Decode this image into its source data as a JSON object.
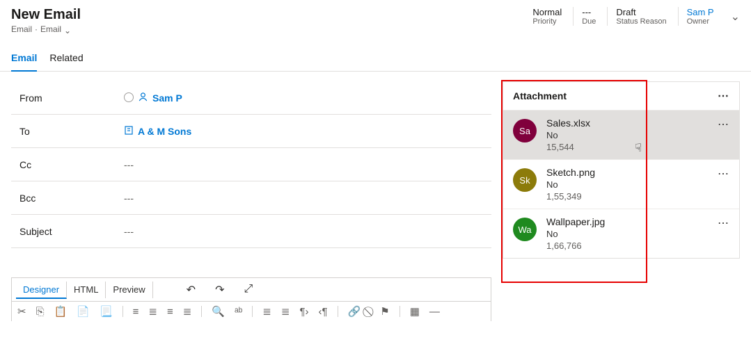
{
  "header": {
    "title": "New Email",
    "breadcrumb1": "Email",
    "breadcrumb2": "Email",
    "status": [
      {
        "label": "Priority",
        "value": "Normal"
      },
      {
        "label": "Due",
        "value": "---"
      },
      {
        "label": "Status Reason",
        "value": "Draft"
      },
      {
        "label": "Owner",
        "value": "Sam P"
      }
    ]
  },
  "tabs": {
    "email": "Email",
    "related": "Related"
  },
  "fields": {
    "from_label": "From",
    "from_value": "Sam P",
    "to_label": "To",
    "to_value": "A & M Sons",
    "cc_label": "Cc",
    "cc_value": "---",
    "bcc_label": "Bcc",
    "bcc_value": "---",
    "subject_label": "Subject",
    "subject_value": "---"
  },
  "designer": {
    "tabs": {
      "designer": "Designer",
      "html": "HTML",
      "preview": "Preview"
    }
  },
  "attachments": {
    "title": "Attachment",
    "items": [
      {
        "avatar": "Sa",
        "name": "Sales.xlsx",
        "flag": "No",
        "size": "15,544"
      },
      {
        "avatar": "Sk",
        "name": "Sketch.png",
        "flag": "No",
        "size": "1,55,349"
      },
      {
        "avatar": "Wa",
        "name": "Wallpaper.jpg",
        "flag": "No",
        "size": "1,66,766"
      }
    ]
  }
}
